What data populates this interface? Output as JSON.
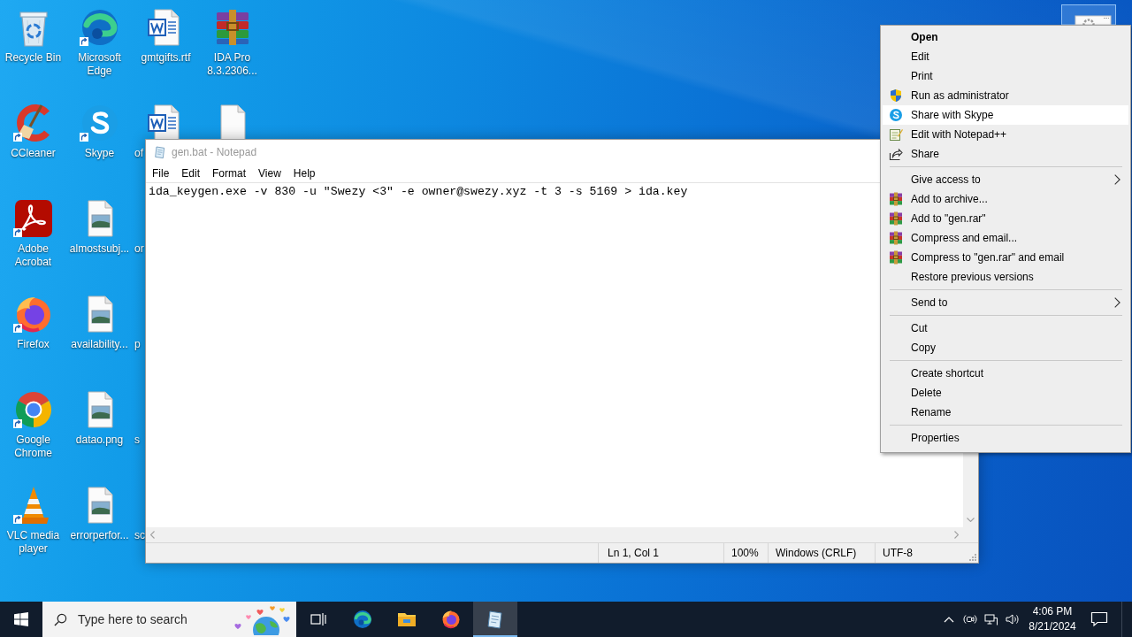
{
  "desktop_icons": [
    {
      "label": "Recycle Bin",
      "shortcut": false,
      "covered": false
    },
    {
      "label": "CCleaner",
      "shortcut": true,
      "covered": false
    },
    {
      "label": "Adobe Acrobat",
      "shortcut": true,
      "covered": false
    },
    {
      "label": "Firefox",
      "shortcut": true,
      "covered": false
    },
    {
      "label": "Google Chrome",
      "shortcut": true,
      "covered": false
    },
    {
      "label": "VLC media player",
      "shortcut": true,
      "covered": false
    },
    {
      "label": "Microsoft Edge",
      "shortcut": true,
      "covered": false
    },
    {
      "label": "Skype",
      "shortcut": true,
      "covered": false
    },
    {
      "label": "almostsubj...",
      "shortcut": false,
      "covered": false
    },
    {
      "label": "availability...",
      "shortcut": false,
      "covered": false
    },
    {
      "label": "datao.png",
      "shortcut": false,
      "covered": false
    },
    {
      "label": "errorperfor...",
      "shortcut": false,
      "covered": false
    },
    {
      "label": "gmtgifts.rtf",
      "shortcut": false,
      "covered": false
    },
    {
      "label": "of",
      "shortcut": false,
      "covered": true
    },
    {
      "label": "or",
      "covered": true
    },
    {
      "label": "p",
      "covered": true
    },
    {
      "label": "s",
      "covered": true
    },
    {
      "label": "sc",
      "covered": true
    },
    {
      "label": "IDA Pro 8.3.2306...",
      "shortcut": false,
      "covered": false
    },
    {
      "shortcut": false,
      "covered": true
    }
  ],
  "notepad": {
    "title": "gen.bat - Notepad",
    "active": false,
    "menu": [
      "File",
      "Edit",
      "Format",
      "View",
      "Help"
    ],
    "text": "ida_keygen.exe -v 830 -u \"Swezy <3\" -e owner@swezy.xyz -t 3 -s 5169 > ida.key",
    "status_bar": {
      "position": "Ln 1, Col 1",
      "zoom": "100%",
      "line_ending": "Windows (CRLF)",
      "encoding": "UTF-8"
    }
  },
  "context_menu": {
    "groups": [
      [
        {
          "label": "Open",
          "default": true,
          "submenu": false,
          "selected": false
        },
        {
          "label": "Edit",
          "default": false,
          "submenu": false,
          "selected": false
        },
        {
          "label": "Print",
          "default": false,
          "submenu": false,
          "selected": false
        },
        {
          "label": "Run as administrator",
          "default": false,
          "submenu": false,
          "selected": false
        },
        {
          "label": "Share with Skype",
          "default": false,
          "submenu": false,
          "selected": true
        },
        {
          "label": "Edit with Notepad++",
          "default": false,
          "submenu": false,
          "selected": false
        },
        {
          "label": "Share",
          "default": false,
          "submenu": false,
          "selected": false
        }
      ],
      [
        {
          "label": "Give access to",
          "default": false,
          "submenu": true,
          "selected": false
        },
        {
          "label": "Add to archive...",
          "default": false,
          "submenu": false,
          "selected": false
        },
        {
          "label": "Add to \"gen.rar\"",
          "default": false,
          "submenu": false,
          "selected": false
        },
        {
          "label": "Compress and email...",
          "default": false,
          "submenu": false,
          "selected": false
        },
        {
          "label": "Compress to \"gen.rar\" and email",
          "default": false,
          "submenu": false,
          "selected": false
        },
        {
          "label": "Restore previous versions",
          "default": false,
          "submenu": false,
          "selected": false
        }
      ],
      [
        {
          "label": "Send to",
          "default": false,
          "submenu": true,
          "selected": false
        }
      ],
      [
        {
          "label": "Cut",
          "default": false,
          "submenu": false,
          "selected": false
        },
        {
          "label": "Copy",
          "default": false,
          "submenu": false,
          "selected": false
        }
      ],
      [
        {
          "label": "Create shortcut",
          "default": false,
          "submenu": false,
          "selected": false
        },
        {
          "label": "Delete",
          "default": false,
          "submenu": false,
          "selected": false
        },
        {
          "label": "Rename",
          "default": false,
          "submenu": false,
          "selected": false
        }
      ],
      [
        {
          "label": "Properties",
          "default": false,
          "submenu": false,
          "selected": false
        }
      ]
    ]
  },
  "taskbar": {
    "search": {
      "placeholder": "Type here to search"
    },
    "apps": [
      {
        "active": false
      },
      {
        "active": false
      },
      {
        "active": false
      },
      {
        "active": true
      }
    ],
    "clock": {
      "time": "4:06 PM",
      "date": "8/21/2024"
    }
  }
}
